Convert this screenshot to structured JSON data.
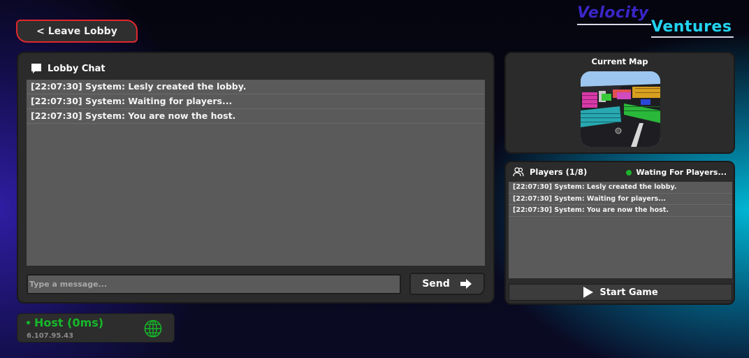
{
  "header": {
    "leave_label": "< Leave Lobby",
    "logo_top": "Velocity",
    "logo_bottom": "Ventures"
  },
  "chat": {
    "title": "Lobby Chat",
    "icon": "chat-bubble-icon",
    "messages": [
      "[22:07:30] System: Lesly created the lobby.",
      "[22:07:30] System: Waiting for players...",
      "[22:07:30] System: You are now the host."
    ],
    "input_placeholder": "Type a message...",
    "send_label": "Send",
    "send_icon": "arrow-right-icon"
  },
  "map": {
    "title": "Current Map"
  },
  "players": {
    "title": "Players (1/8)",
    "icon": "users-icon",
    "status": "Wating For Players...",
    "status_color": "#1db32a",
    "log": [
      "[22:07:30] System: Lesly created the lobby.",
      "[22:07:30] System: Waiting for players...",
      "[22:07:30] System: You are now the host."
    ],
    "start_label": "Start Game",
    "start_icon": "play-icon"
  },
  "host": {
    "status": "Host (0ms)",
    "ip": "6.107.95.43",
    "status_color": "#16b82a",
    "icon": "globe-icon"
  },
  "colors": {
    "danger": "#e0282c",
    "logo_primary": "#3a26c8",
    "logo_secondary": "#22d4f0"
  }
}
